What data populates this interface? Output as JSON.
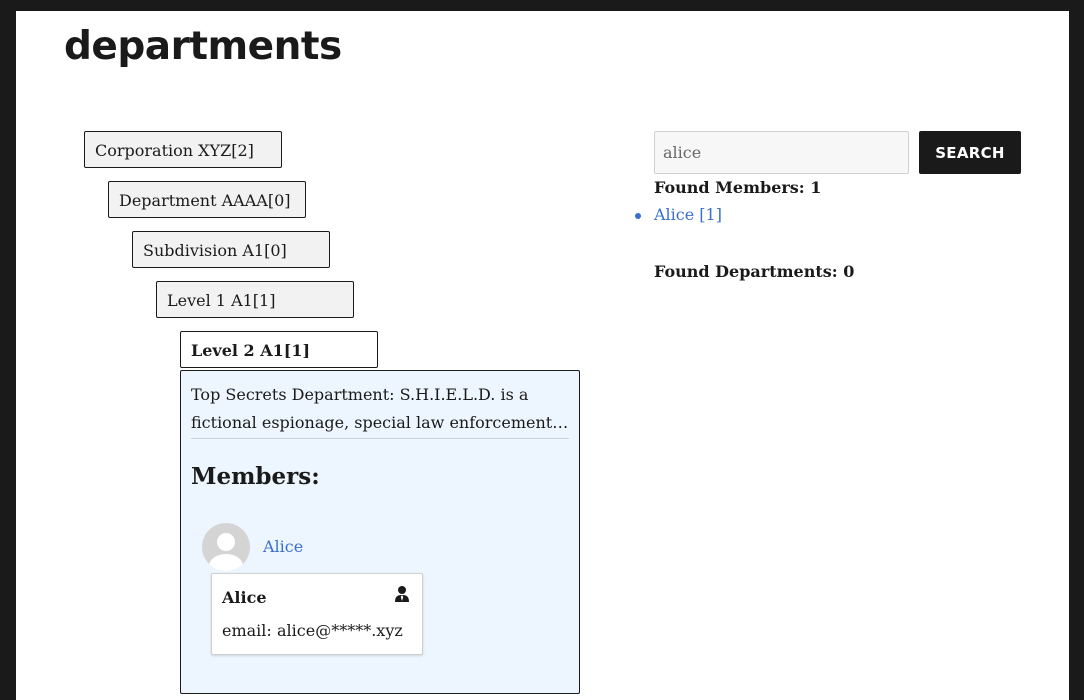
{
  "page": {
    "title": "departments"
  },
  "tree": [
    {
      "label": "Corporation XYZ[2]",
      "active": false
    },
    {
      "label": "Department AAAA[0]",
      "active": false
    },
    {
      "label": "Subdivision A1[0]",
      "active": false
    },
    {
      "label": "Level 1 A1[1]",
      "active": false
    },
    {
      "label": "Level 2 A1[1]",
      "active": true
    }
  ],
  "detail": {
    "description": "Top Secrets Department: S.H.I.E.L.D. is a fictional espionage, special law enforcement…",
    "members_heading": "Members:",
    "members": [
      {
        "name": "Alice",
        "card": {
          "name": "Alice",
          "icon": "user-icon",
          "email_label": "email:",
          "email_value": "alice@*****.xyz"
        }
      }
    ]
  },
  "search": {
    "value": "alice",
    "button_label": "SEARCH",
    "found_members": "Found Members: 1",
    "member_results": [
      "Alice [1]"
    ],
    "found_departments": "Found Departments: 0"
  },
  "colors": {
    "frame": "#1a1a1a",
    "link": "#3a6fcb",
    "detail_background": "#edf6ff",
    "node_background": "#f2f2f2"
  }
}
